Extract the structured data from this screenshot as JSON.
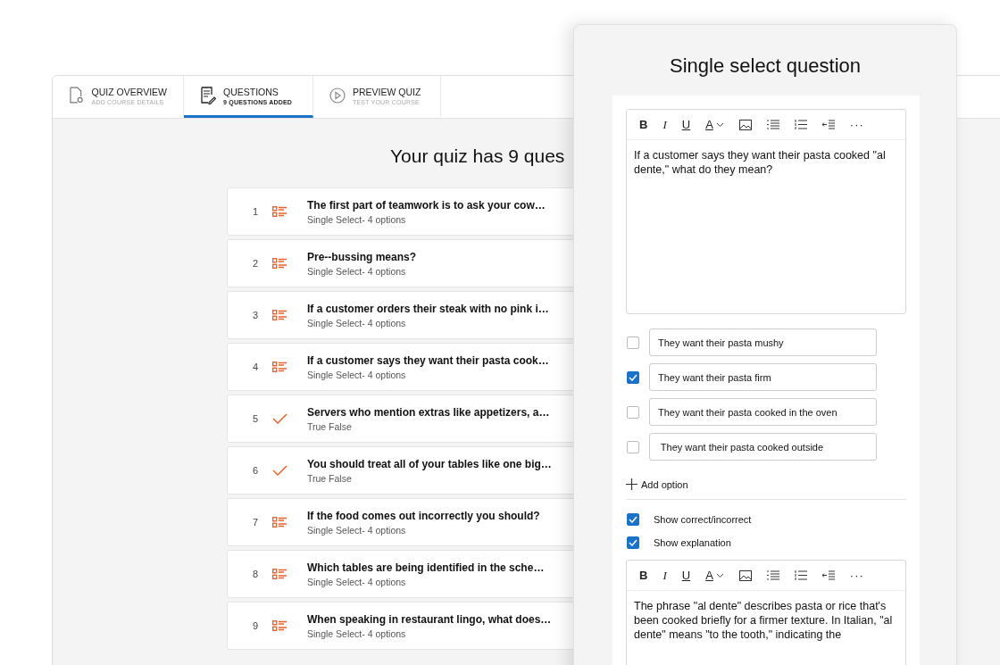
{
  "tabs": [
    {
      "title": "QUIZ OVERVIEW",
      "subtitle": "ADD COURSE DETAILS",
      "selected": false
    },
    {
      "title": "QUESTIONS",
      "subtitle": "9 QUESTIONS ADDED",
      "selected": true
    },
    {
      "title": "PREVIEW QUIZ",
      "subtitle": "TEST YOUR COURSE",
      "selected": false
    }
  ],
  "heading": "Your quiz has 9 ques",
  "questions": [
    {
      "number": "1",
      "kind": "single",
      "title": "The first part of teamwork is to ask your cow…",
      "subtitle": "Single Select- 4 options"
    },
    {
      "number": "2",
      "kind": "single",
      "title": "Pre--bussing means?",
      "subtitle": "Single Select- 4 options"
    },
    {
      "number": "3",
      "kind": "single",
      "title": "If a customer orders their steak with no pink i…",
      "subtitle": "Single Select- 4 options"
    },
    {
      "number": "4",
      "kind": "single",
      "title": "If a customer says they want their pasta cook…",
      "subtitle": "Single Select- 4 options"
    },
    {
      "number": "5",
      "kind": "truefalse",
      "title": "Servers who mention extras like appetizers, a…",
      "subtitle": "True False"
    },
    {
      "number": "6",
      "kind": "truefalse",
      "title": "You should treat all of your tables like one big…",
      "subtitle": "True False"
    },
    {
      "number": "7",
      "kind": "single",
      "title": "If the food comes out incorrectly you should?",
      "subtitle": "Single Select- 4 options"
    },
    {
      "number": "8",
      "kind": "single",
      "title": "Which tables are being identified in the sche…",
      "subtitle": "Single Select- 4 options"
    },
    {
      "number": "9",
      "kind": "single",
      "title": "When speaking in restaurant lingo, what does…",
      "subtitle": "Single Select- 4 options"
    }
  ],
  "panel": {
    "title": "Single select question",
    "question_editor": {
      "toolbar": [
        {
          "kind": "bold",
          "label": "B"
        },
        {
          "kind": "italic",
          "label": "I"
        },
        {
          "kind": "underline",
          "label": "U"
        },
        {
          "kind": "color",
          "label": "A"
        },
        {
          "kind": "image"
        },
        {
          "kind": "bullets"
        },
        {
          "kind": "numbers"
        },
        {
          "kind": "indent"
        },
        {
          "kind": "more",
          "label": "···"
        }
      ],
      "text": "If a customer says they want their pasta cooked \"al dente,\" what do they mean?"
    },
    "options": [
      {
        "text": "They want their pasta mushy",
        "checked": false
      },
      {
        "text": "They want their pasta firm",
        "checked": true
      },
      {
        "text": "They want their pasta cooked in the oven",
        "checked": false
      },
      {
        "text": " They want their pasta cooked outside",
        "checked": false
      }
    ],
    "add_option": "Add option",
    "settings": [
      {
        "label": "Show correct/incorrect",
        "checked": true
      },
      {
        "label": "Show explanation",
        "checked": true
      }
    ],
    "explanation_editor": {
      "toolbar": [
        {
          "kind": "bold",
          "label": "B"
        },
        {
          "kind": "italic",
          "label": "I"
        },
        {
          "kind": "underline",
          "label": "U"
        },
        {
          "kind": "color",
          "label": "A"
        },
        {
          "kind": "image"
        },
        {
          "kind": "bullets"
        },
        {
          "kind": "numbers"
        },
        {
          "kind": "indent"
        },
        {
          "kind": "more",
          "label": "···"
        }
      ],
      "text": "The phrase \"al dente\" describes pasta or rice that's been cooked briefly for a firmer texture. In Italian, \"al dente\" means \"to the tooth,\" indicating the"
    }
  }
}
